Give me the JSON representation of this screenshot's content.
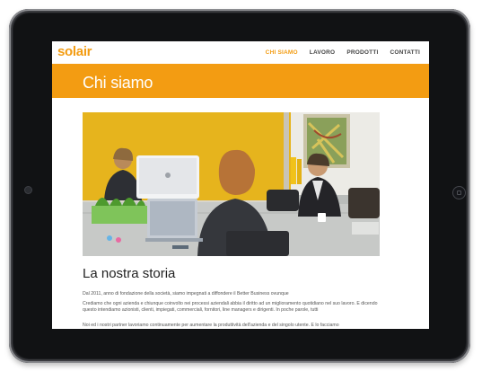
{
  "site": {
    "logo": "solair",
    "nav": [
      {
        "label": "CHI SIAMO",
        "active": true
      },
      {
        "label": "LAVORO",
        "active": false
      },
      {
        "label": "PRODOTTI",
        "active": false
      },
      {
        "label": "CONTATTI",
        "active": false
      }
    ]
  },
  "banner": {
    "title": "Chi siamo"
  },
  "content": {
    "section_title": "La nostra storia",
    "paragraphs": [
      "Dal 2011, anno di fondazione della società, siamo impegnati a diffondere il Better Business ovunque",
      "Crediamo che ogni azienda e chiunque coinvolto nei processi aziendali abbia il diritto ad un miglioramento quotidiano nel suo lavoro. E dicendo questo intendiamo azionisti, clienti, impiegati, commerciali, fornitori, line managers e dirigenti. In poche parole, tutti",
      "Noi ed i nostri partner lavoriamo continuamente per aumentare la produttività dell'azienda e del singolo utente. E lo facciamo"
    ]
  },
  "colors": {
    "accent": "#f39c12",
    "device": "#1c1d20"
  }
}
